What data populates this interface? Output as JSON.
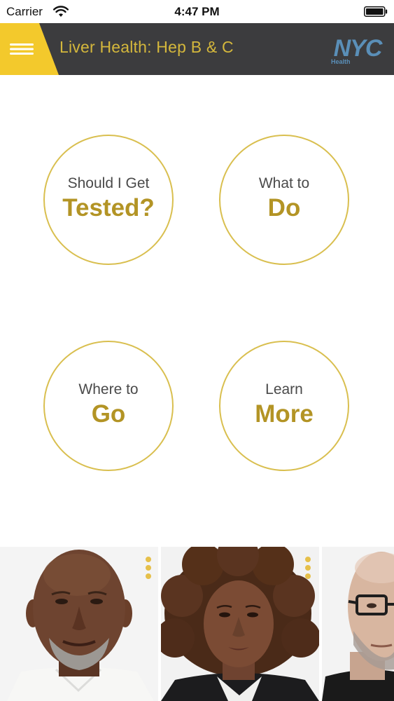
{
  "status_bar": {
    "carrier": "Carrier",
    "time": "4:47 PM"
  },
  "header": {
    "title": "Liver Health: Hep B & C",
    "logo_text": "NYC",
    "logo_subtext": "Health",
    "accent_color": "#f3c92c",
    "bar_color": "#3c3c3e",
    "title_color": "#d4b73c"
  },
  "menu": {
    "buttons": [
      {
        "small": "Should I Get",
        "big": "Tested?"
      },
      {
        "small": "What to",
        "big": "Do"
      },
      {
        "small": "Where to",
        "big": "Go"
      },
      {
        "small": "Learn",
        "big": "More"
      }
    ],
    "circle_color": "#d9bf4f",
    "big_text_color": "#b39425"
  },
  "carousel": {
    "people": [
      "person-1",
      "person-2",
      "person-3"
    ]
  }
}
